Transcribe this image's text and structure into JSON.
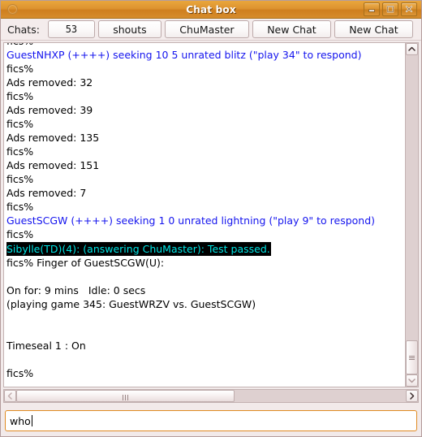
{
  "window": {
    "title": "Chat box",
    "menu_icon": "circle-icon",
    "controls": {
      "minimize": "minimize-icon",
      "maximize": "maximize-icon",
      "close": "close-icon"
    }
  },
  "tabbar": {
    "label": "Chats:",
    "tabs": [
      {
        "label": "53",
        "name": "tab-count"
      },
      {
        "label": "shouts",
        "name": "tab-shouts"
      },
      {
        "label": "ChuMaster",
        "name": "tab-chumaster"
      },
      {
        "label": "New Chat",
        "name": "tab-new-chat-1"
      },
      {
        "label": "New Chat",
        "name": "tab-new-chat-2"
      }
    ]
  },
  "log": {
    "lines": [
      {
        "text": "fics%",
        "style": "plain"
      },
      {
        "text": "GuestNHXP (++++) seeking 10 5 unrated blitz (\"play 34\" to respond)",
        "style": "seek"
      },
      {
        "text": "fics%",
        "style": "plain"
      },
      {
        "text": "Ads removed: 32",
        "style": "plain"
      },
      {
        "text": "fics%",
        "style": "plain"
      },
      {
        "text": "Ads removed: 39",
        "style": "plain"
      },
      {
        "text": "fics%",
        "style": "plain"
      },
      {
        "text": "Ads removed: 135",
        "style": "plain"
      },
      {
        "text": "fics%",
        "style": "plain"
      },
      {
        "text": "Ads removed: 151",
        "style": "plain"
      },
      {
        "text": "fics%",
        "style": "plain"
      },
      {
        "text": "Ads removed: 7",
        "style": "plain"
      },
      {
        "text": "fics%",
        "style": "plain"
      },
      {
        "text": "GuestSCGW (++++) seeking 1 0 unrated lightning (\"play 9\" to respond)",
        "style": "seek"
      },
      {
        "text": "fics%",
        "style": "plain"
      },
      {
        "text": "Sibylle(TD)(4): (answering ChuMaster): Test passed.",
        "style": "highlight"
      },
      {
        "text": "fics% Finger of GuestSCGW(U):",
        "style": "plain"
      },
      {
        "text": "",
        "style": "blank"
      },
      {
        "text": "On for: 9 mins   Idle: 0 secs",
        "style": "plain"
      },
      {
        "text": "(playing game 345: GuestWRZV vs. GuestSCGW)",
        "style": "plain"
      },
      {
        "text": "",
        "style": "blank"
      },
      {
        "text": "",
        "style": "blank"
      },
      {
        "text": "Timeseal 1 : On",
        "style": "plain"
      },
      {
        "text": "",
        "style": "blank"
      },
      {
        "text": "fics%",
        "style": "plain"
      }
    ],
    "colors": {
      "seek_text": "#1414ee",
      "highlight_bg": "#000000",
      "highlight_text": "#00e5e5",
      "plain_text": "#000000"
    }
  },
  "scrollbars": {
    "vertical": {
      "up_icon": "chevron-up-icon",
      "down_icon": "chevron-down-icon",
      "thumb_grip": "grip-icon"
    },
    "horizontal": {
      "left_icon": "chevron-left-icon",
      "right_icon": "chevron-right-icon",
      "thumb_grip": "grip-icon"
    }
  },
  "input": {
    "value": "who",
    "placeholder": ""
  },
  "theme": {
    "titlebar_accent": "#dd9330",
    "focus_border": "#e08b22",
    "window_bg": "#f2eaea"
  }
}
